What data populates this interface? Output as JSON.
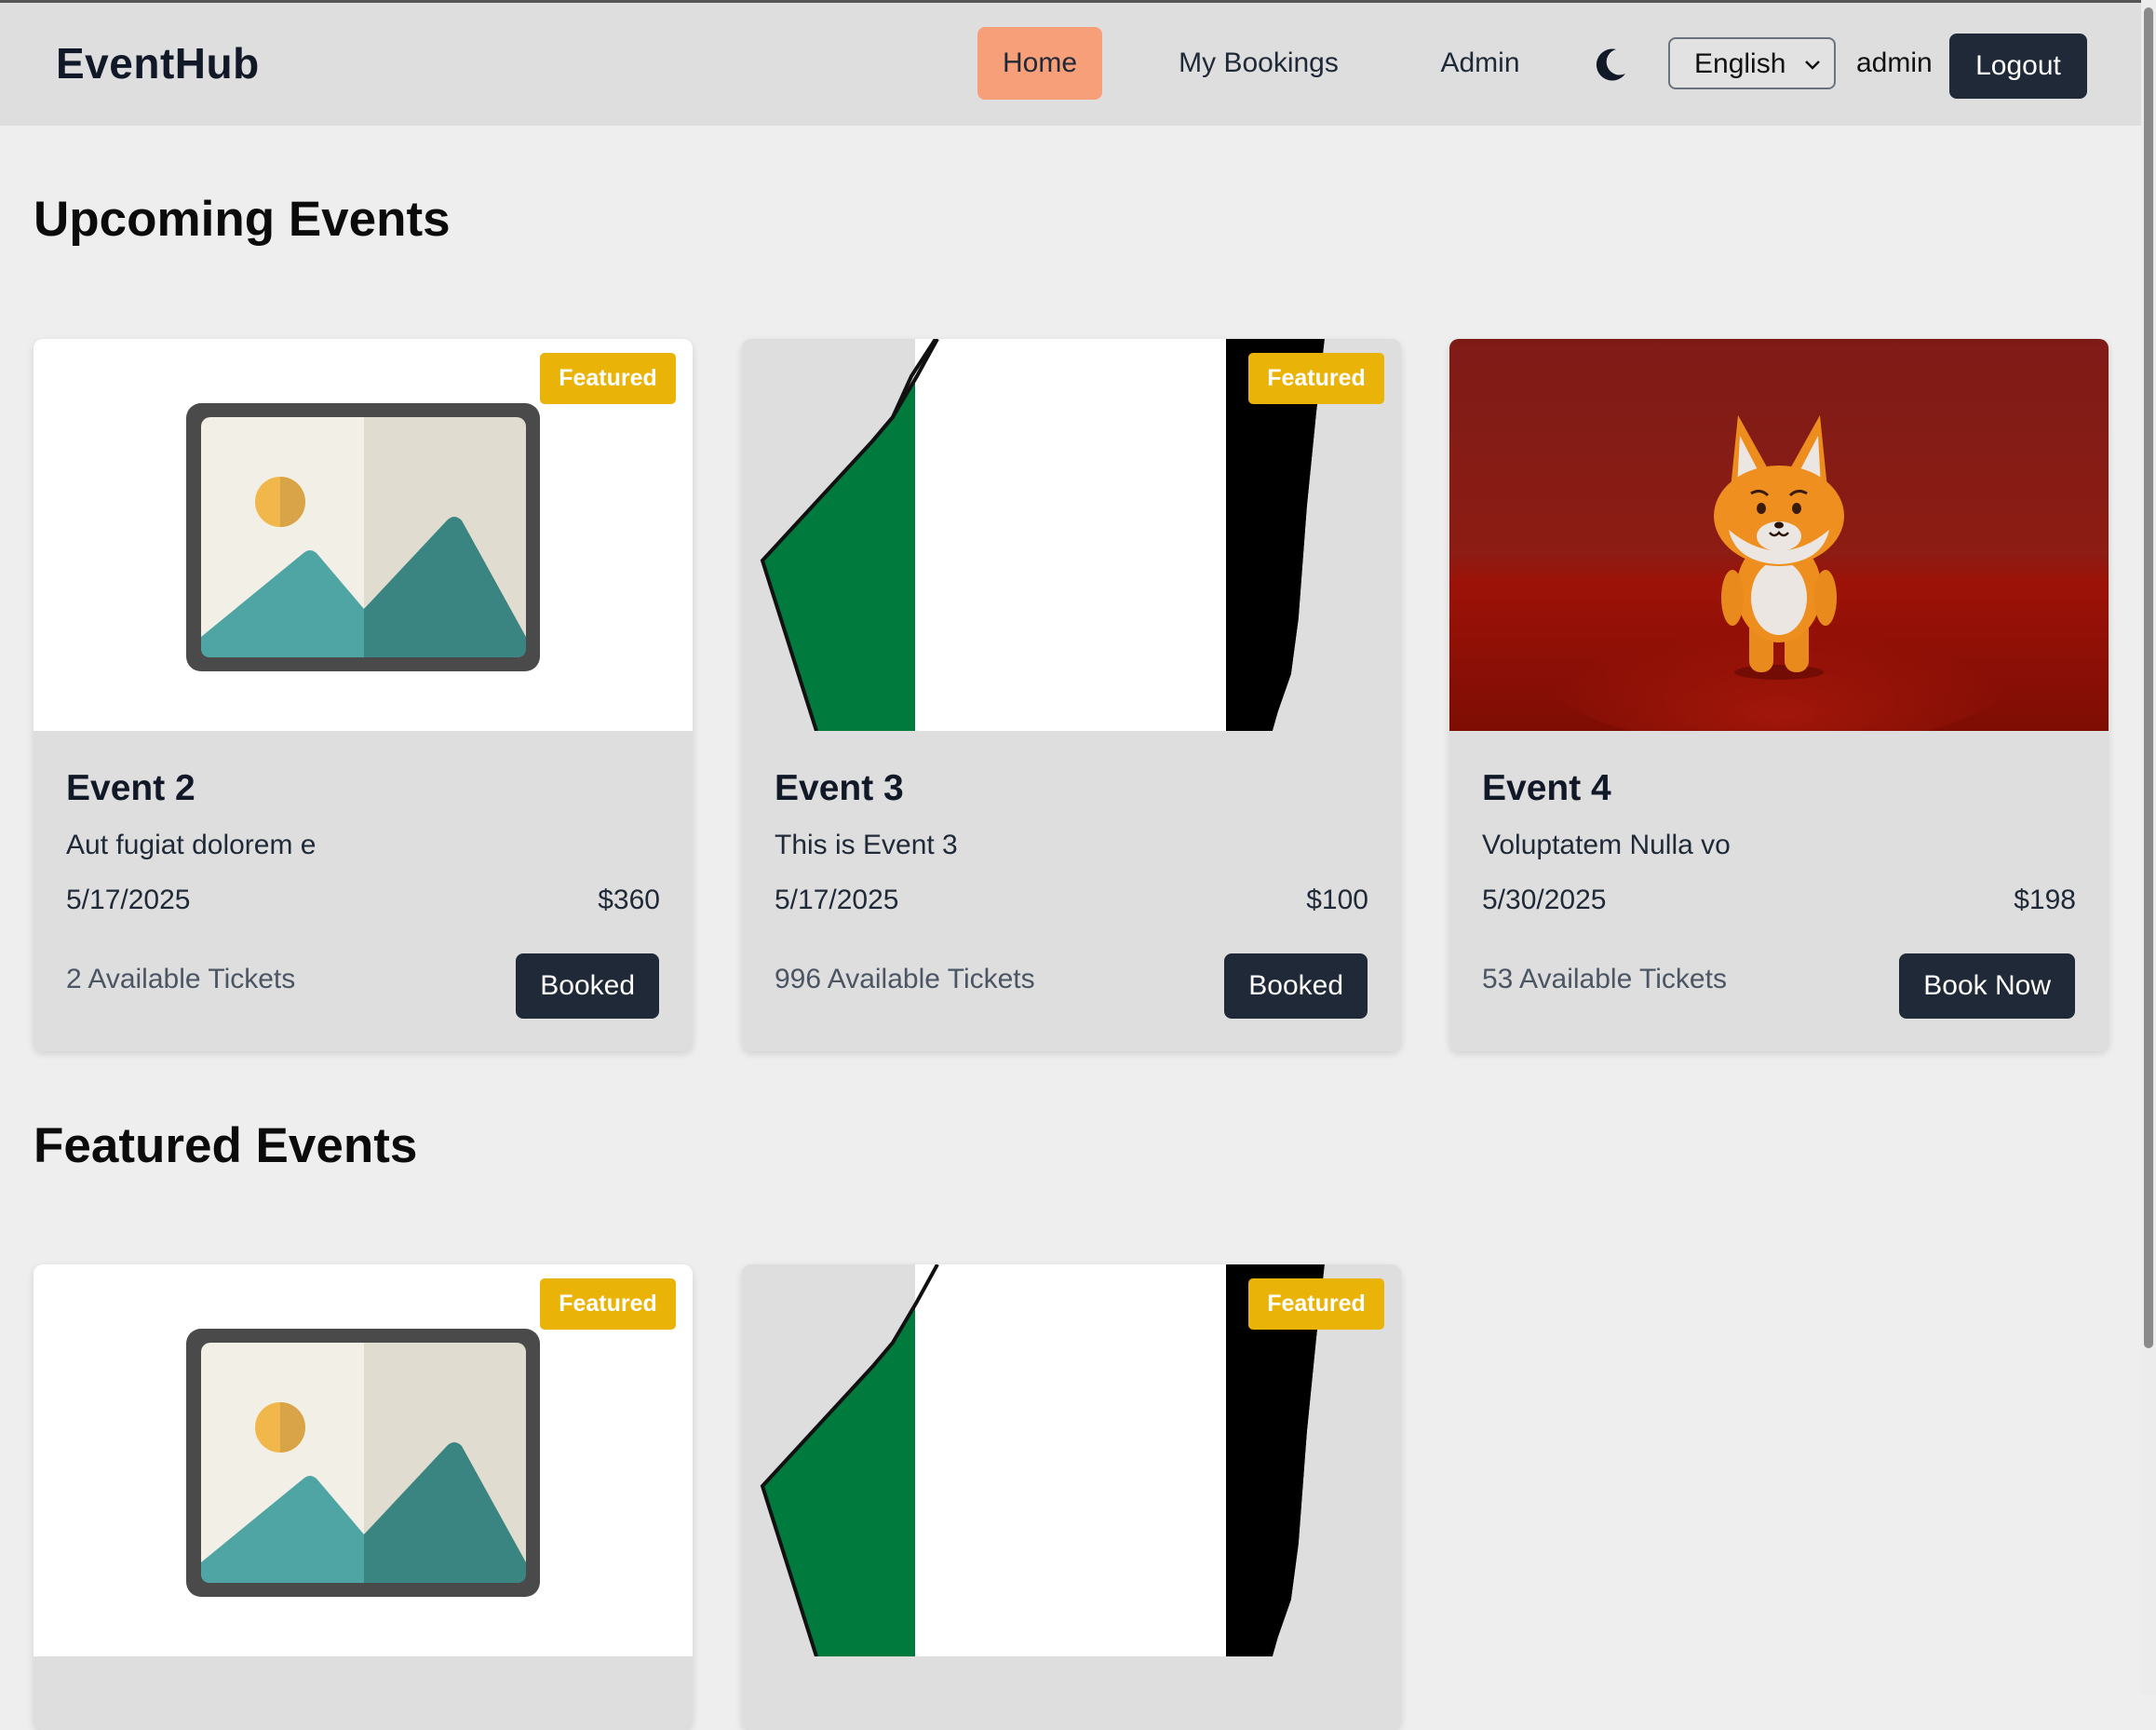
{
  "app": {
    "brand": "EventHub"
  },
  "nav": {
    "items": [
      {
        "label": "Home",
        "active": true
      },
      {
        "label": "My Bookings",
        "active": false
      },
      {
        "label": "Admin",
        "active": false
      }
    ],
    "theme_toggle_icon": "moon-icon",
    "language": "English",
    "username": "admin",
    "logout_label": "Logout"
  },
  "sections": {
    "upcoming_title": "Upcoming Events",
    "featured_title": "Featured Events"
  },
  "upcoming_events": [
    {
      "title": "Event 2",
      "description": "Aut fugiat dolorem e",
      "date": "5/17/2025",
      "price": "$360",
      "tickets": "2 Available Tickets",
      "button": "Booked",
      "featured_label": "Featured",
      "image": "placeholder-landscape-image"
    },
    {
      "title": "Event 3",
      "description": "This is Event 3",
      "date": "5/17/2025",
      "price": "$100",
      "tickets": "996 Available Tickets",
      "button": "Booked",
      "featured_label": "Featured",
      "image": "green-white-black-flag-image"
    },
    {
      "title": "Event 4",
      "description": "Voluptatem Nulla vo",
      "date": "5/30/2025",
      "price": "$198",
      "tickets": "53 Available Tickets",
      "button": "Book Now",
      "featured_label": "",
      "image": "orange-fox-figure-image"
    }
  ],
  "featured_events": [
    {
      "featured_label": "Featured",
      "image": "placeholder-landscape-image"
    },
    {
      "featured_label": "Featured",
      "image": "green-white-black-flag-image"
    }
  ],
  "colors": {
    "accent_nav": "#f79f79",
    "dark_button": "#1f2937",
    "badge": "#eab308"
  }
}
